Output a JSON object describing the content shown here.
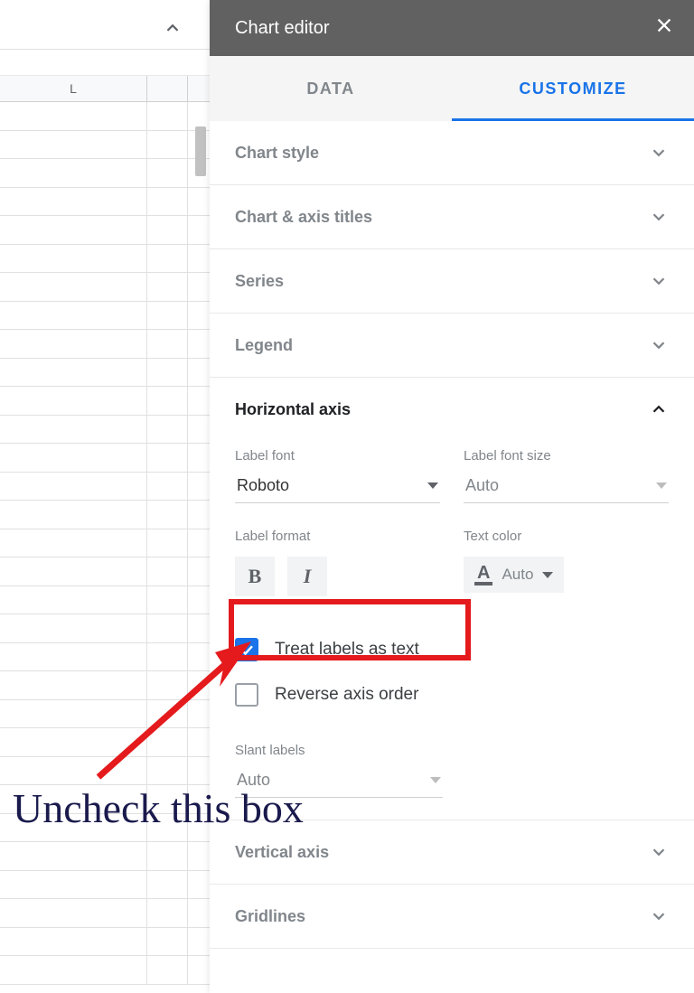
{
  "sheet": {
    "column_header": "L"
  },
  "panel": {
    "title": "Chart editor",
    "tabs": {
      "data": "DATA",
      "customize": "CUSTOMIZE"
    },
    "sections": {
      "chart_style": "Chart style",
      "chart_axis_titles": "Chart & axis titles",
      "series": "Series",
      "legend": "Legend",
      "horizontal_axis": {
        "title": "Horizontal axis",
        "label_font_label": "Label font",
        "label_font_value": "Roboto",
        "label_font_size_label": "Label font size",
        "label_font_size_value": "Auto",
        "label_format_label": "Label format",
        "text_color_label": "Text color",
        "text_color_value": "Auto",
        "treat_labels_as_text": "Treat labels as text",
        "reverse_axis_order": "Reverse axis order",
        "slant_labels_label": "Slant labels",
        "slant_labels_value": "Auto"
      },
      "vertical_axis": "Vertical axis",
      "gridlines": "Gridlines"
    }
  },
  "annotation": {
    "text": "Uncheck this box"
  }
}
